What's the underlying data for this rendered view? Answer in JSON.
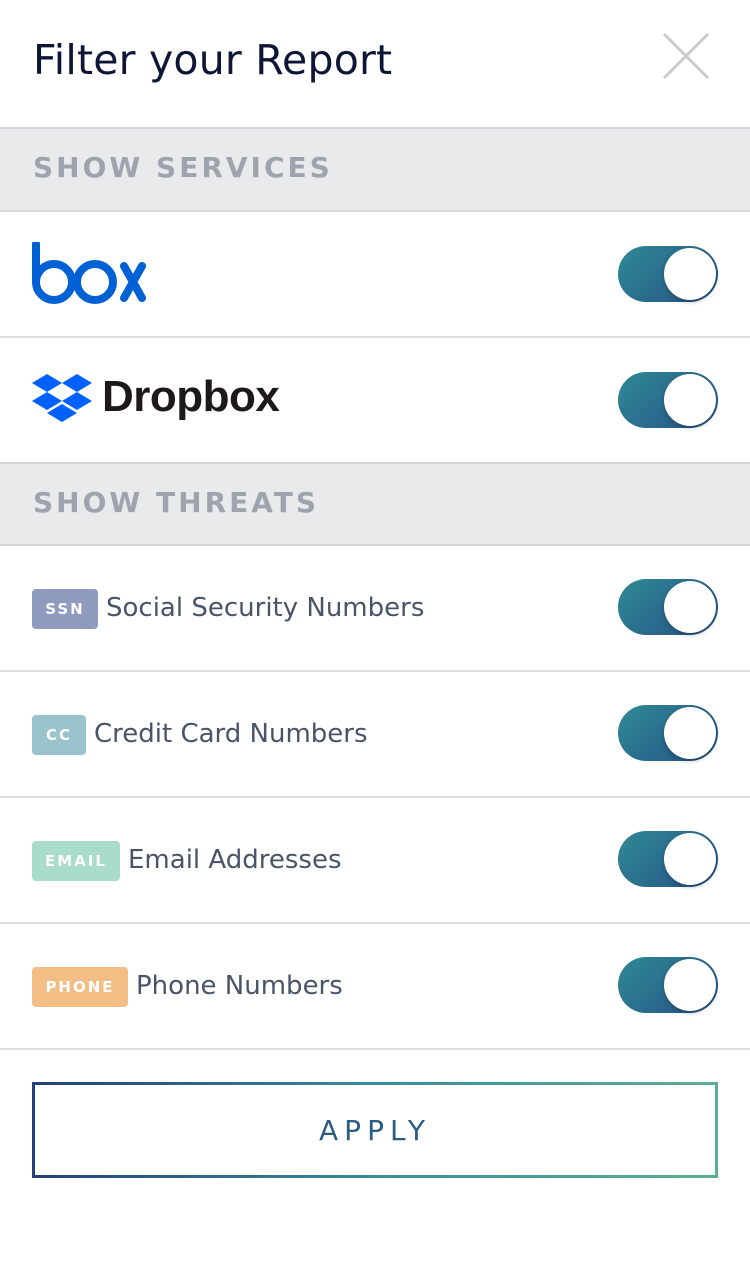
{
  "header": {
    "title": "Filter your Report"
  },
  "sections": {
    "services_title": "SHOW SERVICES",
    "threats_title": "SHOW THREATS"
  },
  "services": [
    {
      "name": "box",
      "enabled": true,
      "color": "#0061d5"
    },
    {
      "name": "Dropbox",
      "enabled": true,
      "color": "#0061fe"
    }
  ],
  "threats": [
    {
      "badge": "SSN",
      "label": "Social Security Numbers",
      "badge_color": "#8e9bbf",
      "enabled": true
    },
    {
      "badge": "CC",
      "label": "Credit Card Numbers",
      "badge_color": "#9bc3cd",
      "enabled": true
    },
    {
      "badge": "EMAIL",
      "label": "Email Addresses",
      "badge_color": "#a9dcca",
      "enabled": true
    },
    {
      "badge": "PHONE",
      "label": "Phone Numbers",
      "badge_color": "#f3bd86",
      "enabled": true
    }
  ],
  "apply": {
    "label": "APPLY"
  },
  "colors": {
    "accent_start": "#264f86",
    "accent_end": "#2f8a94"
  }
}
